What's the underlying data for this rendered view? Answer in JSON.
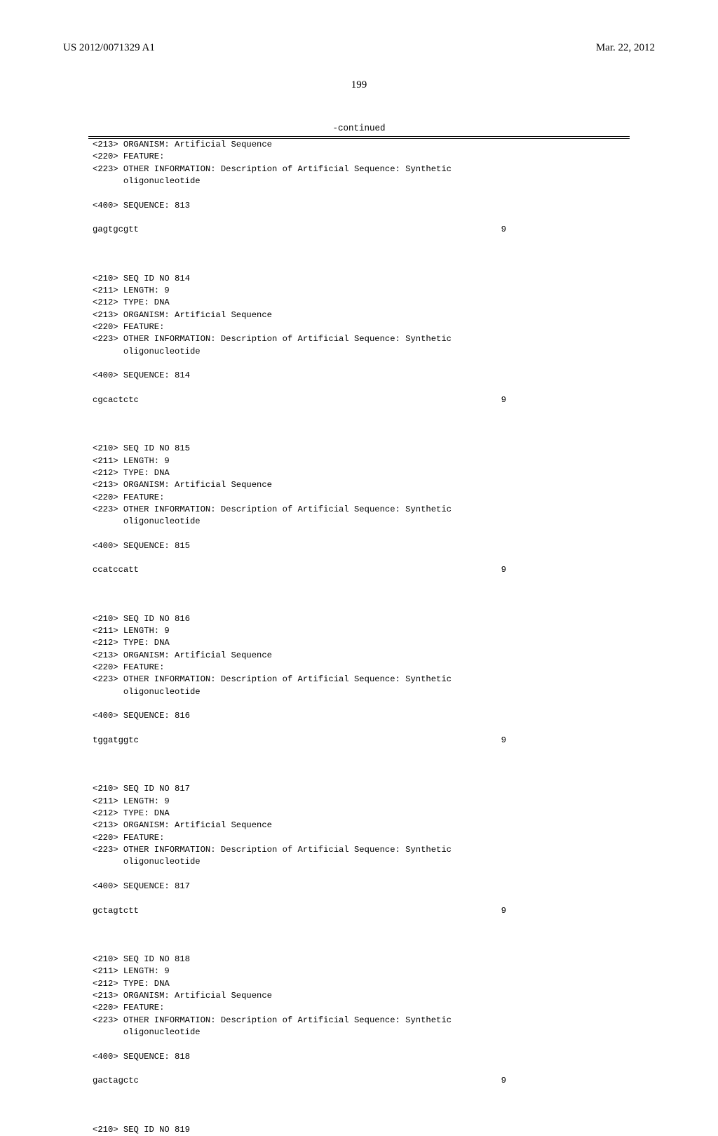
{
  "header": {
    "publication_number": "US 2012/0071329 A1",
    "publication_date": "Mar. 22, 2012"
  },
  "page_number": "199",
  "continued_label": "-continued",
  "sequences": [
    {
      "id": "813",
      "prefix_lines": [
        "<213> ORGANISM: Artificial Sequence",
        "<220> FEATURE:",
        "<223> OTHER INFORMATION: Description of Artificial Sequence: Synthetic",
        "      oligonucleotide"
      ],
      "seq_header": "<400> SEQUENCE: 813",
      "sequence": "gagtgcgtt",
      "length_label": "9"
    },
    {
      "id": "814",
      "prefix_lines": [
        "<210> SEQ ID NO 814",
        "<211> LENGTH: 9",
        "<212> TYPE: DNA",
        "<213> ORGANISM: Artificial Sequence",
        "<220> FEATURE:",
        "<223> OTHER INFORMATION: Description of Artificial Sequence: Synthetic",
        "      oligonucleotide"
      ],
      "seq_header": "<400> SEQUENCE: 814",
      "sequence": "cgcactctc",
      "length_label": "9"
    },
    {
      "id": "815",
      "prefix_lines": [
        "<210> SEQ ID NO 815",
        "<211> LENGTH: 9",
        "<212> TYPE: DNA",
        "<213> ORGANISM: Artificial Sequence",
        "<220> FEATURE:",
        "<223> OTHER INFORMATION: Description of Artificial Sequence: Synthetic",
        "      oligonucleotide"
      ],
      "seq_header": "<400> SEQUENCE: 815",
      "sequence": "ccatccatt",
      "length_label": "9"
    },
    {
      "id": "816",
      "prefix_lines": [
        "<210> SEQ ID NO 816",
        "<211> LENGTH: 9",
        "<212> TYPE: DNA",
        "<213> ORGANISM: Artificial Sequence",
        "<220> FEATURE:",
        "<223> OTHER INFORMATION: Description of Artificial Sequence: Synthetic",
        "      oligonucleotide"
      ],
      "seq_header": "<400> SEQUENCE: 816",
      "sequence": "tggatggtc",
      "length_label": "9"
    },
    {
      "id": "817",
      "prefix_lines": [
        "<210> SEQ ID NO 817",
        "<211> LENGTH: 9",
        "<212> TYPE: DNA",
        "<213> ORGANISM: Artificial Sequence",
        "<220> FEATURE:",
        "<223> OTHER INFORMATION: Description of Artificial Sequence: Synthetic",
        "      oligonucleotide"
      ],
      "seq_header": "<400> SEQUENCE: 817",
      "sequence": "gctagtctt",
      "length_label": "9"
    },
    {
      "id": "818",
      "prefix_lines": [
        "<210> SEQ ID NO 818",
        "<211> LENGTH: 9",
        "<212> TYPE: DNA",
        "<213> ORGANISM: Artificial Sequence",
        "<220> FEATURE:",
        "<223> OTHER INFORMATION: Description of Artificial Sequence: Synthetic",
        "      oligonucleotide"
      ],
      "seq_header": "<400> SEQUENCE: 818",
      "sequence": "gactagctc",
      "length_label": "9"
    }
  ],
  "trailing_line": "<210> SEQ ID NO 819"
}
